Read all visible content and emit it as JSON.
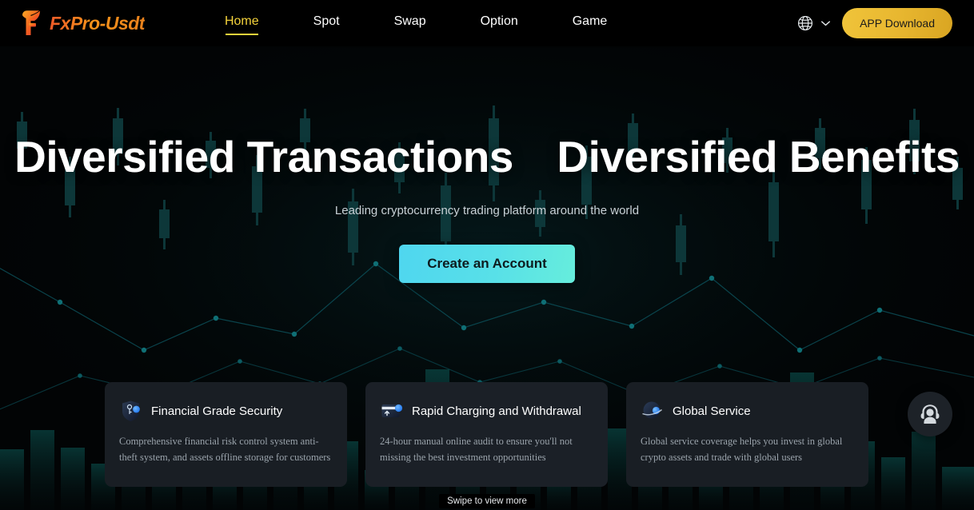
{
  "header": {
    "logo_text": "FxPro-Usdt",
    "logo_icon": "fxpro-f-logo-icon",
    "nav": [
      {
        "label": "Home",
        "active": true
      },
      {
        "label": "Spot",
        "active": false
      },
      {
        "label": "Swap",
        "active": false
      },
      {
        "label": "Option",
        "active": false
      },
      {
        "label": "Game",
        "active": false
      }
    ],
    "language_icon": "globe-icon",
    "language_chevron_icon": "chevron-down-icon",
    "app_download_label": "APP Download"
  },
  "hero": {
    "title": "Diversified Transactions Diversified Benefits",
    "subtitle": "Leading cryptocurrency trading platform around the world",
    "cta_label": "Create an Account"
  },
  "cards": [
    {
      "icon": "shield-key-icon",
      "title": "Financial Grade Security",
      "body": "Comprehensive financial risk control system anti-theft system, and assets offline storage for customers"
    },
    {
      "icon": "card-deposit-arrow-icon",
      "title": "Rapid Charging and Withdrawal",
      "body": "24-hour manual online audit to ensure you'll not missing the best investment opportunities"
    },
    {
      "icon": "planet-globe-icon",
      "title": "Global Service",
      "body": "Global service coverage helps you invest in global crypto assets and trade with global users"
    }
  ],
  "swipe_hint": "Swipe to view more",
  "support_fab": {
    "icon": "customer-support-headset-icon"
  },
  "colors": {
    "page_bg": "#020405",
    "accent_yellow": "#f5d33b",
    "brand_orange": "#f7931a",
    "cta_cyan": "#4fd6ef",
    "card_bg": "#191e24",
    "candle_teal": "#0f3d3f",
    "line_teal": "#0e6e72",
    "text_white": "#ffffff",
    "text_muted": "#9aa3ab"
  }
}
